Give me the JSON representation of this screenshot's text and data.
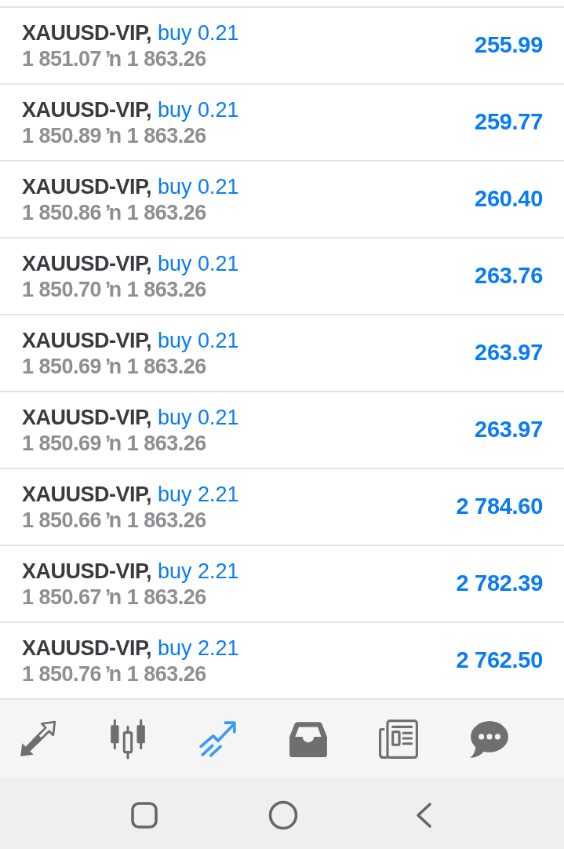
{
  "positions": [
    {
      "symbol": "XAUUSD-VIP,",
      "order": "buy 0.21",
      "prices": "1 851.07 ŉ 1 863.26",
      "profit": "255.99"
    },
    {
      "symbol": "XAUUSD-VIP,",
      "order": "buy 0.21",
      "prices": "1 850.89 ŉ 1 863.26",
      "profit": "259.77"
    },
    {
      "symbol": "XAUUSD-VIP,",
      "order": "buy 0.21",
      "prices": "1 850.86 ŉ 1 863.26",
      "profit": "260.40"
    },
    {
      "symbol": "XAUUSD-VIP,",
      "order": "buy 0.21",
      "prices": "1 850.70 ŉ 1 863.26",
      "profit": "263.76"
    },
    {
      "symbol": "XAUUSD-VIP,",
      "order": "buy 0.21",
      "prices": "1 850.69 ŉ 1 863.26",
      "profit": "263.97"
    },
    {
      "symbol": "XAUUSD-VIP,",
      "order": "buy 0.21",
      "prices": "1 850.69 ŉ 1 863.26",
      "profit": "263.97"
    },
    {
      "symbol": "XAUUSD-VIP,",
      "order": "buy 2.21",
      "prices": "1 850.66 ŉ 1 863.26",
      "profit": "2 784.60"
    },
    {
      "symbol": "XAUUSD-VIP,",
      "order": "buy 2.21",
      "prices": "1 850.67 ŉ 1 863.26",
      "profit": "2 782.39"
    },
    {
      "symbol": "XAUUSD-VIP,",
      "order": "buy 2.21",
      "prices": "1 850.76 ŉ 1 863.26",
      "profit": "2 762.50"
    }
  ],
  "tab_bar": {
    "tabs": [
      {
        "kind": "quotes",
        "selected": false
      },
      {
        "kind": "chart",
        "selected": false
      },
      {
        "kind": "trade",
        "selected": true
      },
      {
        "kind": "history",
        "selected": false
      },
      {
        "kind": "news",
        "selected": false
      },
      {
        "kind": "messages",
        "selected": false
      }
    ]
  },
  "system_nav": {
    "buttons": [
      {
        "kind": "recents"
      },
      {
        "kind": "home"
      },
      {
        "kind": "back"
      }
    ]
  }
}
